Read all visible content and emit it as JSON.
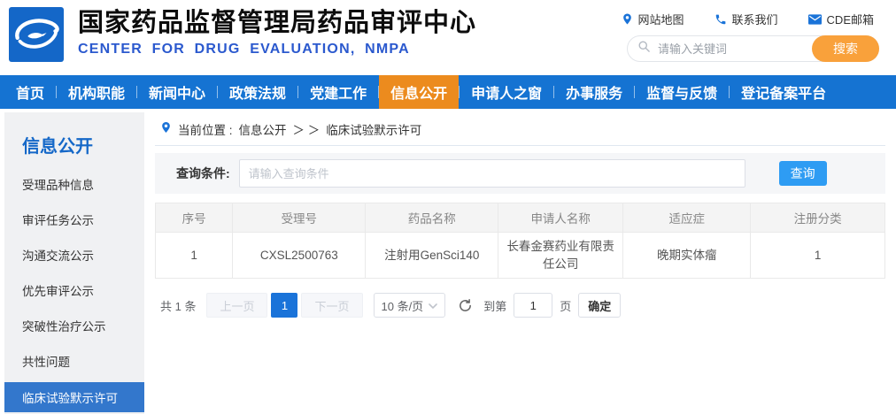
{
  "colors": {
    "nav_blue": "#1573d2",
    "nav_active_orange": "#ec8b1e",
    "search_button_orange": "#f9a13b",
    "query_button_blue": "#2e9cf3",
    "sidebar_active_blue": "#3377cc",
    "pagination_active_blue": "#1a73d9",
    "subtitle_blue": "#2b59ce",
    "link_icon_blue": "#1a73d8"
  },
  "header": {
    "title": "国家药品监督管理局药品审评中心",
    "subtitle": "CENTER FOR DRUG EVALUATION, NMPA",
    "quick_links": [
      {
        "icon": "location-pin-icon",
        "label": "网站地图"
      },
      {
        "icon": "phone-icon",
        "label": "联系我们"
      },
      {
        "icon": "envelope-icon",
        "label": "CDE邮箱"
      }
    ],
    "search": {
      "placeholder": "请输入关键词",
      "button_label": "搜索"
    }
  },
  "nav": {
    "items": [
      {
        "label": "首页",
        "active": false
      },
      {
        "label": "机构职能",
        "active": false
      },
      {
        "label": "新闻中心",
        "active": false
      },
      {
        "label": "政策法规",
        "active": false
      },
      {
        "label": "党建工作",
        "active": false
      },
      {
        "label": "信息公开",
        "active": true
      },
      {
        "label": "申请人之窗",
        "active": false
      },
      {
        "label": "办事服务",
        "active": false
      },
      {
        "label": "监督与反馈",
        "active": false
      },
      {
        "label": "登记备案平台",
        "active": false
      }
    ]
  },
  "sidebar": {
    "title": "信息公开",
    "items": [
      {
        "label": "受理品种信息",
        "active": false
      },
      {
        "label": "审评任务公示",
        "active": false
      },
      {
        "label": "沟通交流公示",
        "active": false
      },
      {
        "label": "优先审评公示",
        "active": false
      },
      {
        "label": "突破性治疗公示",
        "active": false
      },
      {
        "label": "共性问题",
        "active": false
      },
      {
        "label": "临床试验默示许可",
        "active": true
      }
    ]
  },
  "breadcrumb": {
    "prefix": "当前位置 :",
    "section": "信息公开",
    "separator": "＞ ＞",
    "page": "临床试验默示许可"
  },
  "query": {
    "label": "查询条件:",
    "placeholder": "请输入查询条件",
    "button_label": "查询"
  },
  "table": {
    "columns": [
      "序号",
      "受理号",
      "药品名称",
      "申请人名称",
      "适应症",
      "注册分类"
    ],
    "rows": [
      [
        "1",
        "CXSL2500763",
        "注射用GenSci140",
        "长春金赛药业有限责任公司",
        "晚期实体瘤",
        "1"
      ]
    ]
  },
  "pagination": {
    "total": "共 1 条",
    "prev_label": "上一页",
    "current_page": "1",
    "next_label": "下一页",
    "page_size": "10 条/页",
    "goto_label": "到第",
    "goto_value": "1",
    "page_unit": "页",
    "confirm_label": "确定"
  }
}
